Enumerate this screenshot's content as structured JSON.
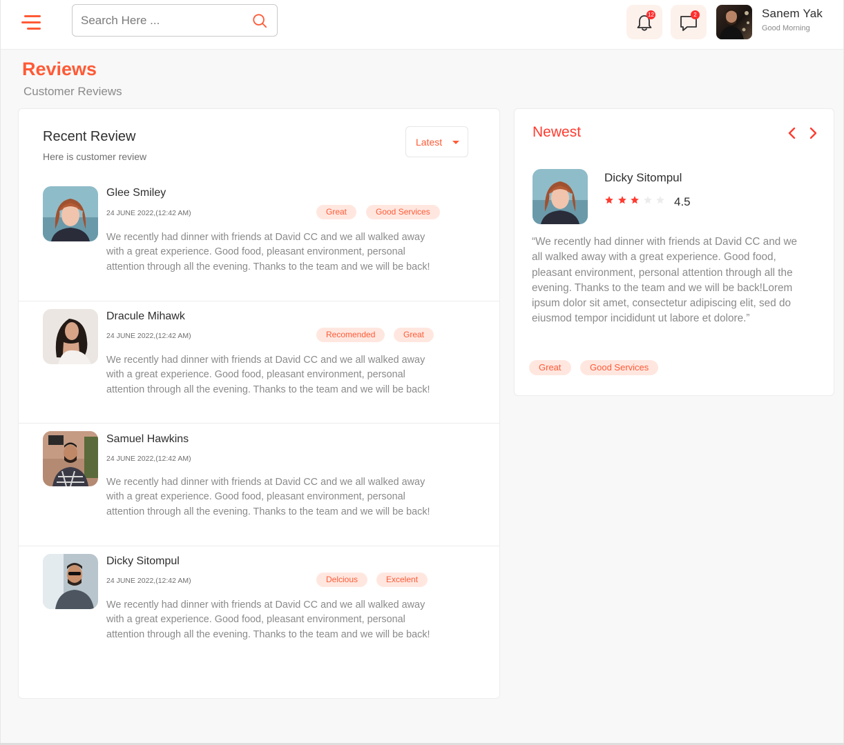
{
  "header": {
    "search_placeholder": "Search Here ...",
    "notifications_count": "12",
    "messages_count": "2",
    "user_name": "Sanem Yak",
    "user_greeting": "Good Morning"
  },
  "page": {
    "title": "Reviews",
    "subtitle": "Customer Reviews"
  },
  "recent": {
    "title": "Recent Review",
    "subtitle": "Here is customer review",
    "sort_selected": "Latest",
    "reviews": [
      {
        "name": "Glee Smiley",
        "date": "24 JUNE 2022,(12:42 AM)",
        "tags": [
          "Great",
          "Good Services"
        ],
        "text": "We recently had dinner with friends at David CC and we all walked away with a great experience. Good food, pleasant environment, personal attention through all the evening. Thanks to the team and we will be back!"
      },
      {
        "name": "Dracule Mihawk",
        "date": "24 JUNE 2022,(12:42 AM)",
        "tags": [
          "Recomended",
          "Great"
        ],
        "text": "We recently had dinner with friends at David CC and we all walked away with a great experience. Good food, pleasant environment, personal attention through all the evening. Thanks to the team and we will be back!"
      },
      {
        "name": "Samuel Hawkins",
        "date": "24 JUNE 2022,(12:42 AM)",
        "tags": [],
        "text": "We recently had dinner with friends at David CC and we all walked away with a great experience. Good food, pleasant environment, personal attention through all the evening. Thanks to the team and we will be back!"
      },
      {
        "name": "Dicky Sitompul",
        "date": "24 JUNE 2022,(12:42 AM)",
        "tags": [
          "Delcious",
          "Excelent"
        ],
        "text": "We recently had dinner with friends at David CC and we all walked away with a great experience. Good food, pleasant environment, personal attention through all the evening. Thanks to the team and we will be back!"
      }
    ]
  },
  "newest": {
    "title": "Newest",
    "name": "Dicky Sitompul",
    "stars_filled": 3,
    "stars_total": 5,
    "rating": "4.5",
    "text": "“We recently had dinner with friends at David CC and we all walked away with a great experience. Good food, pleasant environment, personal attention through all the evening. Thanks to the team and we will be back!Lorem ipsum dolor sit amet, consectetur adipiscing elit, sed do eiusmod tempor incididunt ut labore et dolore.”",
    "tags": [
      "Great",
      "Good Services"
    ]
  },
  "colors": {
    "accent": "#ff5a36",
    "accent_dark": "#ff3b2f",
    "tag_bg": "#ffe7e0",
    "star_filled": "#ff3b2f",
    "star_empty": "#ececec"
  }
}
